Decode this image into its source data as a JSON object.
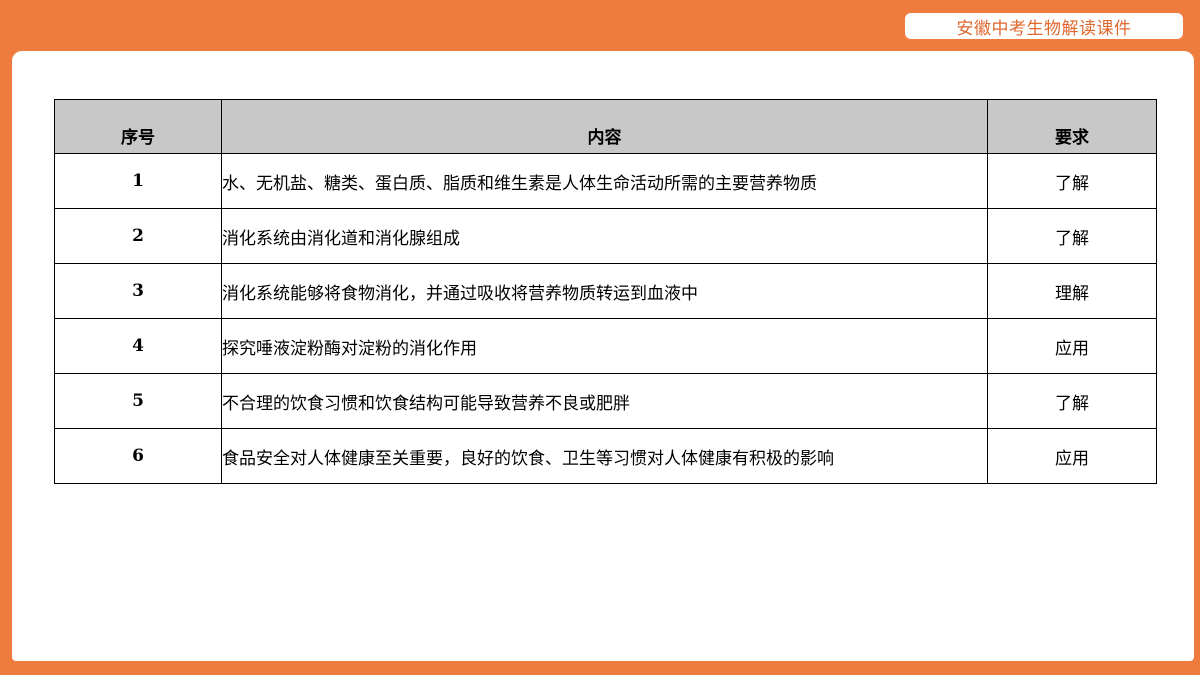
{
  "header": {
    "badge_text": "安徽中考生物解读课件"
  },
  "table": {
    "columns": [
      "序号",
      "内容",
      "要求"
    ],
    "rows": [
      {
        "index": "1",
        "content": "水、无机盐、糖类、蛋白质、脂质和维生素是人体生命活动所需的主要营养物质",
        "requirement": "了解"
      },
      {
        "index": "2",
        "content": "消化系统由消化道和消化腺组成",
        "requirement": "了解"
      },
      {
        "index": "3",
        "content": "消化系统能够将食物消化，并通过吸收将营养物质转运到血液中",
        "requirement": "理解"
      },
      {
        "index": "4",
        "content": "探究唾液淀粉酶对淀粉的消化作用",
        "requirement": "应用"
      },
      {
        "index": "5",
        "content": "不合理的饮食习惯和饮食结构可能导致营养不良或肥胖",
        "requirement": "了解"
      },
      {
        "index": "6",
        "content": "食品安全对人体健康至关重要，良好的饮食、卫生等习惯对人体健康有积极的影响",
        "requirement": "应用"
      }
    ]
  },
  "colors": {
    "frame": "#ED7C3E",
    "badge_text": "#E0672E",
    "header_fill": "#C8C8C8"
  }
}
